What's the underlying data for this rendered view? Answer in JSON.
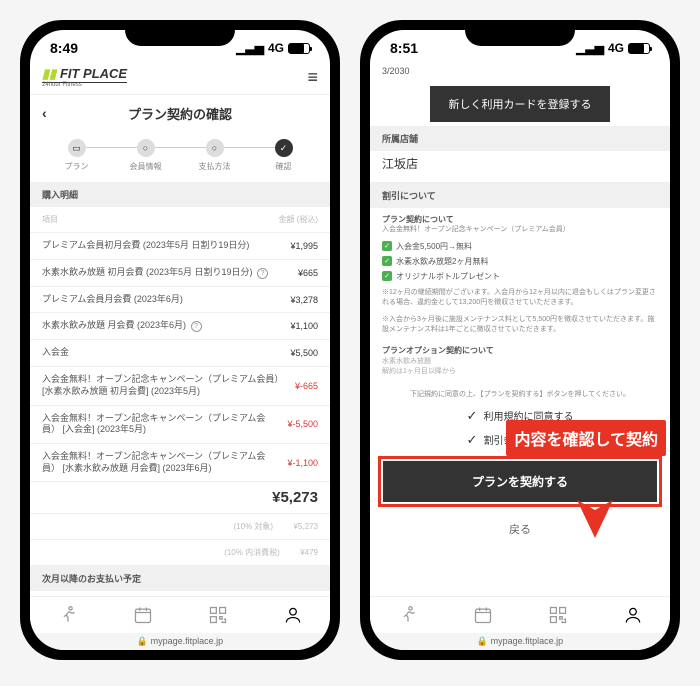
{
  "left": {
    "time": "8:49",
    "signal": "4G",
    "logo_main": "FIT PLACE",
    "logo_sub": "24hour Fitness",
    "page_title": "プラン契約の確認",
    "steps": [
      {
        "label": "プラン",
        "icon": "▭"
      },
      {
        "label": "会員情報",
        "icon": "○"
      },
      {
        "label": "支払方法",
        "icon": "○"
      },
      {
        "label": "確認",
        "icon": "✓"
      }
    ],
    "section1": "購入明細",
    "header_row": {
      "l": "項目",
      "r": "金額 (税込)"
    },
    "rows": [
      {
        "l": "プレミアム会員初月会費 (2023年5月 日割り19日分)",
        "r": "¥1,995"
      },
      {
        "l": "水素水飲み放題 初月会費 (2023年5月 日割り19日分)",
        "help": true,
        "r": "¥665"
      },
      {
        "l": "プレミアム会員月会費 (2023年6月)",
        "r": "¥3,278"
      },
      {
        "l": "水素水飲み放題 月会費 (2023年6月)",
        "help": true,
        "r": "¥1,100"
      },
      {
        "l": "入会金",
        "r": "¥5,500"
      },
      {
        "l": "入会金無料！オープン記念キャンペーン（プレミアム会員）\n[水素水飲み放題 初月会費] (2023年5月)",
        "r": "¥-665",
        "red": true
      },
      {
        "l": "入会金無料！オープン記念キャンペーン（プレミアム会員）\n[入会金] (2023年5月)",
        "r": "¥-5,500",
        "red": true
      },
      {
        "l": "入会金無料！オープン記念キャンペーン（プレミアム会員）\n[水素水飲み放題 月会費] (2023年6月)",
        "r": "¥-1,100",
        "red": true
      }
    ],
    "total": "¥5,273",
    "sub1": {
      "l": "(10% 対象)",
      "r": "¥5,273"
    },
    "sub2": {
      "l": "(10% 内消費税)",
      "r": "¥479"
    },
    "next_section": "次月以降のお支払い予定",
    "url": "mypage.fitplace.jp"
  },
  "right": {
    "time": "8:51",
    "signal": "4G",
    "top_date": "3/2030",
    "register_btn": "新しく利用カードを登録する",
    "store_header": "所属店舗",
    "store_name": "江坂店",
    "discount_header": "割引について",
    "campaign_title": "プラン契約について",
    "campaign_sub": "入会金無料！オープン記念キャンペーン（プレミアム会員）",
    "checks": [
      "入会金5,500円→無料",
      "水素水飲み放題2ヶ月無料",
      "オリジナルボトルプレゼント"
    ],
    "note1": "※12ヶ月の継続期間がございます。入会月から12ヶ月以内に退会もしくはプラン変更される場合、違約金として13,200円を徴収させていただきます。",
    "note2": "※入会から3ヶ月後に施設メンテナンス料として5,500円を徴収させていただきます。施設メンテナンス料は1年ごとに徴収させていただきます。",
    "option_title": "プランオプション契約について",
    "option_sub1": "水素水飲み放題",
    "option_sub2": "解約は1ヶ月目以降から",
    "callout": "内容を確認して契約",
    "agree_note": "下記規約に同意の上、【プランを契約する】ボタンを押してください。",
    "agree1": "利用規約に同意する",
    "agree2": "割引条件に同意する",
    "contract_btn": "プランを契約する",
    "back_btn": "戻る",
    "url": "mypage.fitplace.jp"
  }
}
